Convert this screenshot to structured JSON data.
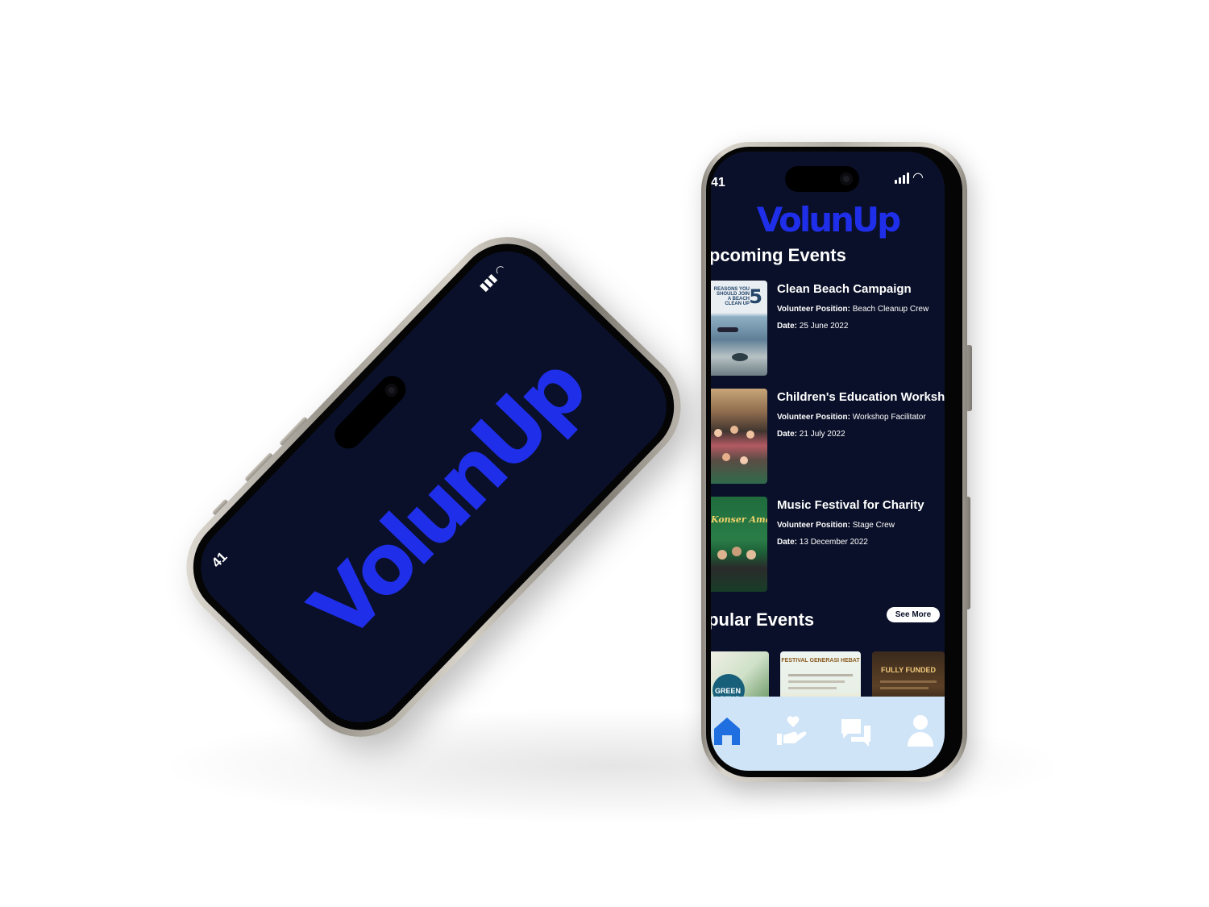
{
  "splash": {
    "time": "41",
    "logo": "VolunUp"
  },
  "app": {
    "time": "41",
    "logo": "VolunUp",
    "upcoming_title": "Upcoming Events",
    "events": [
      {
        "title": "Clean Beach Campaign",
        "position_label": "Volunteer Position:",
        "position": "Beach Cleanup Crew",
        "date_label": "Date:",
        "date": "25 June 2022",
        "thumb_text": "REASONS YOU SHOULD JOIN A BEACH CLEAN UP",
        "thumb_number": "5"
      },
      {
        "title": "Children's Education Workshop",
        "position_label": "Volunteer Position:",
        "position": "Workshop Facilitator",
        "date_label": "Date:",
        "date": "21 July 2022"
      },
      {
        "title": "Music Festival for Charity",
        "position_label": "Volunteer Position:",
        "position": "Stage Crew",
        "date_label": "Date:",
        "date": "13 December 2022",
        "thumb_text": "Konser Amal"
      }
    ],
    "see_more": "See More",
    "popular_title": "Popular Events",
    "popular": [
      {
        "text": "GREEN LIVING"
      },
      {
        "text": "FESTIVAL GENERASI HEBAT"
      },
      {
        "text": "FULLY FUNDED"
      }
    ],
    "tabs": [
      {
        "icon": "home-icon",
        "active": true
      },
      {
        "icon": "volunteer-heart-hand-icon",
        "active": false
      },
      {
        "icon": "chat-icon",
        "active": false
      },
      {
        "icon": "profile-icon",
        "active": false
      }
    ],
    "colors": {
      "background": "#0a1029",
      "brand": "#1f2ee8",
      "tabbar": "#cfe4f7",
      "tab_icon": "#1f6fe0"
    }
  }
}
